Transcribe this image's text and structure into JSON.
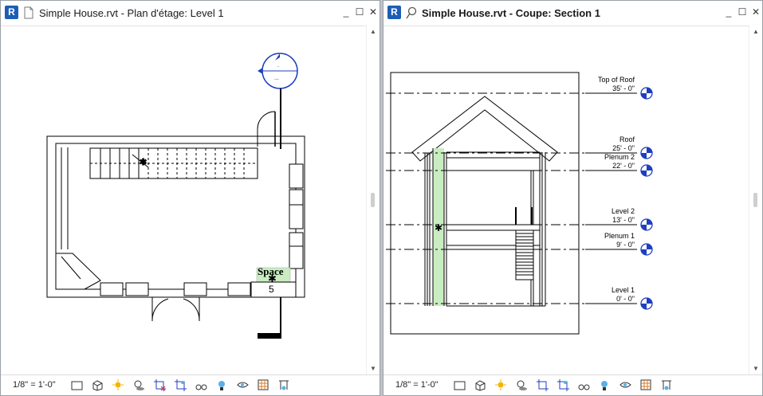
{
  "left_window": {
    "app_icon": "R",
    "title": "Simple House.rvt - Plan d'étage: Level 1",
    "scale": "1/8\" = 1'-0\"",
    "space_tag": {
      "name": "Space",
      "number": "5"
    }
  },
  "right_window": {
    "app_icon": "R",
    "title": "Simple House.rvt - Coupe: Section 1",
    "scale": "1/8\" = 1'-0\"",
    "levels": [
      {
        "name": "Top of Roof",
        "elevation": "35' - 0\""
      },
      {
        "name": "Roof",
        "elevation": "25' - 0\""
      },
      {
        "name": "Plenum 2",
        "elevation": "22' - 0\""
      },
      {
        "name": "Level 2",
        "elevation": "13' - 0\""
      },
      {
        "name": "Plenum 1",
        "elevation": "9' - 0\""
      },
      {
        "name": "Level 1",
        "elevation": "0' - 0\""
      }
    ]
  },
  "window_buttons": {
    "minimize": "_",
    "maximize": "☐",
    "close": "✕"
  },
  "colors": {
    "accent": "#1d5db5",
    "level_marker": "#1f3fbf",
    "space_fill": "#c9edc0",
    "section_head": "#1f3fbf"
  }
}
